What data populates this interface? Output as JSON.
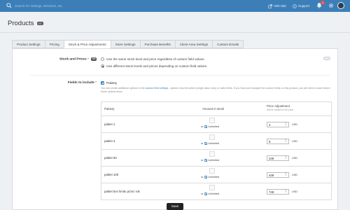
{
  "topbar": {
    "search_placeholder": "Search for settings, elections, etc",
    "visit_site": "Visit Site",
    "support": "Support",
    "notification_count": "1",
    "colors": {
      "bar": "#3c7fb8"
    }
  },
  "header": {
    "title": "Products",
    "count_badge": "9.5"
  },
  "tabs": [
    {
      "label": "Product Settings",
      "active": false
    },
    {
      "label": "Pricing",
      "active": false
    },
    {
      "label": "Stock & Price Adjustments",
      "active": true
    },
    {
      "label": "Store Settings",
      "active": false
    },
    {
      "label": "Purchase Benefits",
      "active": false
    },
    {
      "label": "Client Area Settings",
      "active": false
    },
    {
      "label": "Custom Emails",
      "active": false
    }
  ],
  "stock_prices": {
    "label": "Stock and Prices",
    "required": "*",
    "info_badge": "9.5",
    "option_same": "Use the same stock level and price regardless of custom field values.",
    "option_different": "Use different stock levels and prices depending on custom field values.",
    "selected": "different"
  },
  "fields": {
    "label": "Fields to include",
    "required": "*",
    "checkbox_label": "Pakiety",
    "help_before": "You can create additional options in the ",
    "help_link": "custom field settings",
    "help_after": " - options must be select (single value only) or radio fields. If you have just changed the custom fields on this product, you will need to save before those options show."
  },
  "table": {
    "col_name": "Pakiety",
    "col_stock": "Amount in stock",
    "col_price": "Price Adjustment",
    "col_price_sub": "Will be added to the price",
    "or_label": "or",
    "unlimited_label": "Unlimited",
    "currency": "USD",
    "rows": [
      {
        "name": "pakiet 1",
        "price": "4"
      },
      {
        "name": "pakiet 3",
        "price": "9"
      },
      {
        "name": "pakiet 50",
        "price": "249"
      },
      {
        "name": "pakiet 100",
        "price": "449"
      },
      {
        "name": "pakiet bez limitu przez rok",
        "price": "749"
      }
    ]
  },
  "save_label": "Save"
}
